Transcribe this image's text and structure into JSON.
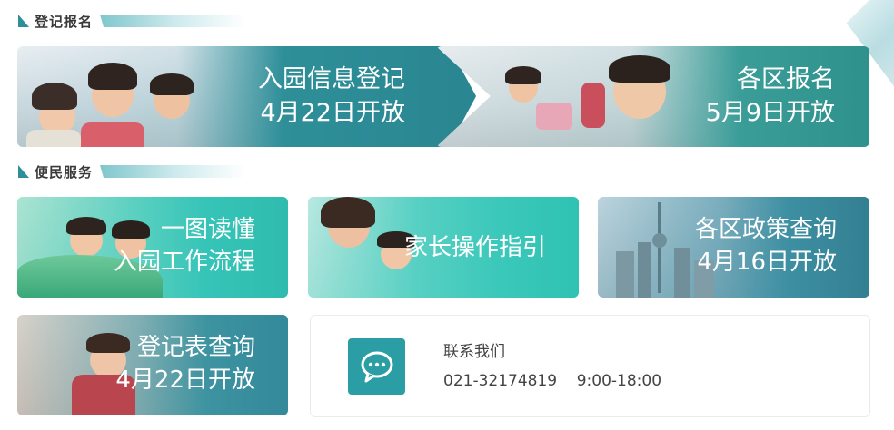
{
  "sections": {
    "registration": {
      "title": "登记报名"
    },
    "services": {
      "title": "便民服务"
    }
  },
  "banners": {
    "info_registration": {
      "line1": "入园信息登记",
      "line2": "4月22日开放"
    },
    "district_signup": {
      "line1": "各区报名",
      "line2": "5月9日开放"
    }
  },
  "tiles": {
    "one_picture": {
      "line1": "一图读懂",
      "line2": "入园工作流程"
    },
    "parent_guide": {
      "line1": "家长操作指引"
    },
    "district_policy": {
      "line1": "各区政策查询",
      "line2": "4月16日开放"
    },
    "form_query": {
      "line1": "登记表查询",
      "line2": "4月22日开放"
    }
  },
  "contact": {
    "title": "联系我们",
    "phone": "021-32174819",
    "hours": "9:00-18:00",
    "icon": "chat-bubble-icon"
  },
  "colors": {
    "accent": "#2a9da5",
    "banner_teal": "#2f8a94",
    "section_mark": "#2f8f99"
  }
}
